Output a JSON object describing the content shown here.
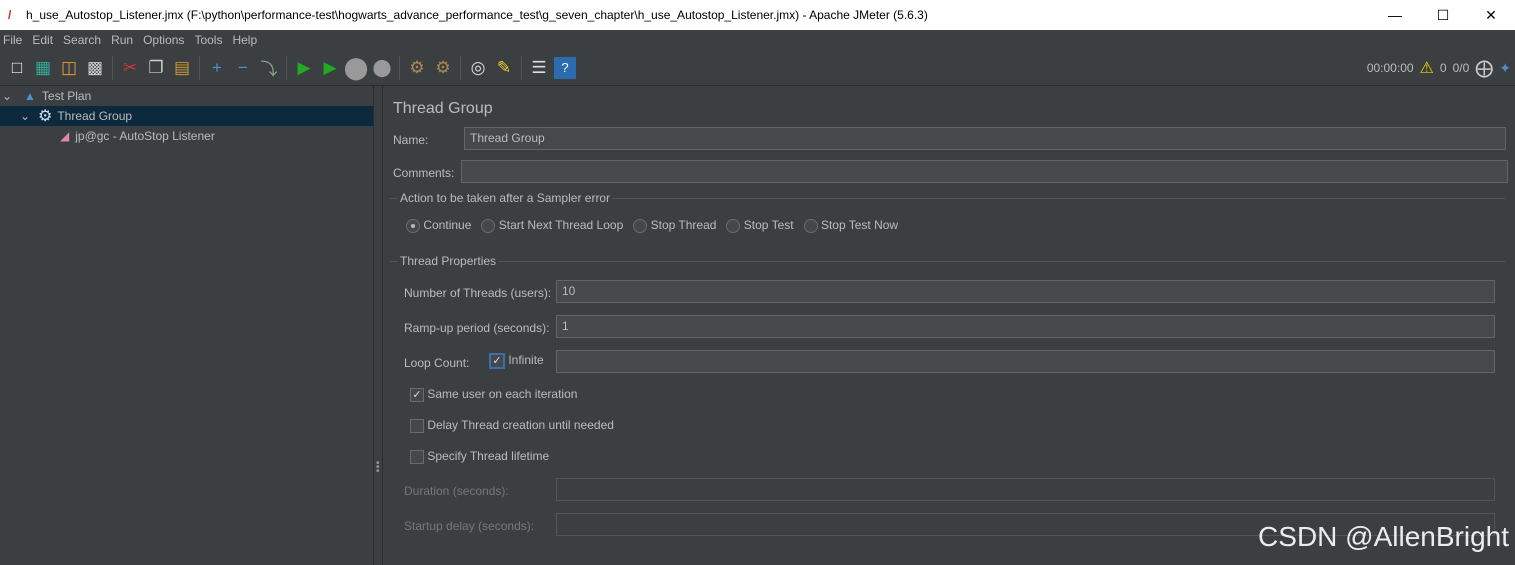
{
  "window": {
    "title": "h_use_Autostop_Listener.jmx (F:\\python\\performance-test\\hogwarts_advance_performance_test\\g_seven_chapter\\h_use_Autostop_Listener.jmx) - Apache JMeter (5.6.3)"
  },
  "menu": [
    "File",
    "Edit",
    "Search",
    "Run",
    "Options",
    "Tools",
    "Help"
  ],
  "status": {
    "elapsed": "00:00:00",
    "warnings": "0",
    "threads": "0/0"
  },
  "tree": {
    "test_plan": "Test Plan",
    "thread_group": "Thread Group",
    "listener": "jp@gc - AutoStop Listener"
  },
  "panel": {
    "title": "Thread Group",
    "name_label": "Name:",
    "name_value": "Thread Group",
    "comments_label": "Comments:",
    "comments_value": "",
    "error_section": "Action to be taken after a Sampler error",
    "error_options": [
      "Continue",
      "Start Next Thread Loop",
      "Stop Thread",
      "Stop Test",
      "Stop Test Now"
    ],
    "error_selected": "Continue",
    "props_section": "Thread Properties",
    "threads_label": "Number of Threads (users):",
    "threads_value": "10",
    "rampup_label": "Ramp-up period (seconds):",
    "rampup_value": "1",
    "loop_label": "Loop Count:",
    "infinite_label": "Infinite",
    "infinite_checked": true,
    "loop_value": "",
    "same_user_label": "Same user on each iteration",
    "same_user_checked": true,
    "delay_label": "Delay Thread creation until needed",
    "delay_checked": false,
    "lifetime_label": "Specify Thread lifetime",
    "lifetime_checked": false,
    "duration_label": "Duration (seconds):",
    "duration_value": "",
    "startup_label": "Startup delay (seconds):",
    "startup_value": ""
  },
  "watermark": "CSDN @AllenBright"
}
